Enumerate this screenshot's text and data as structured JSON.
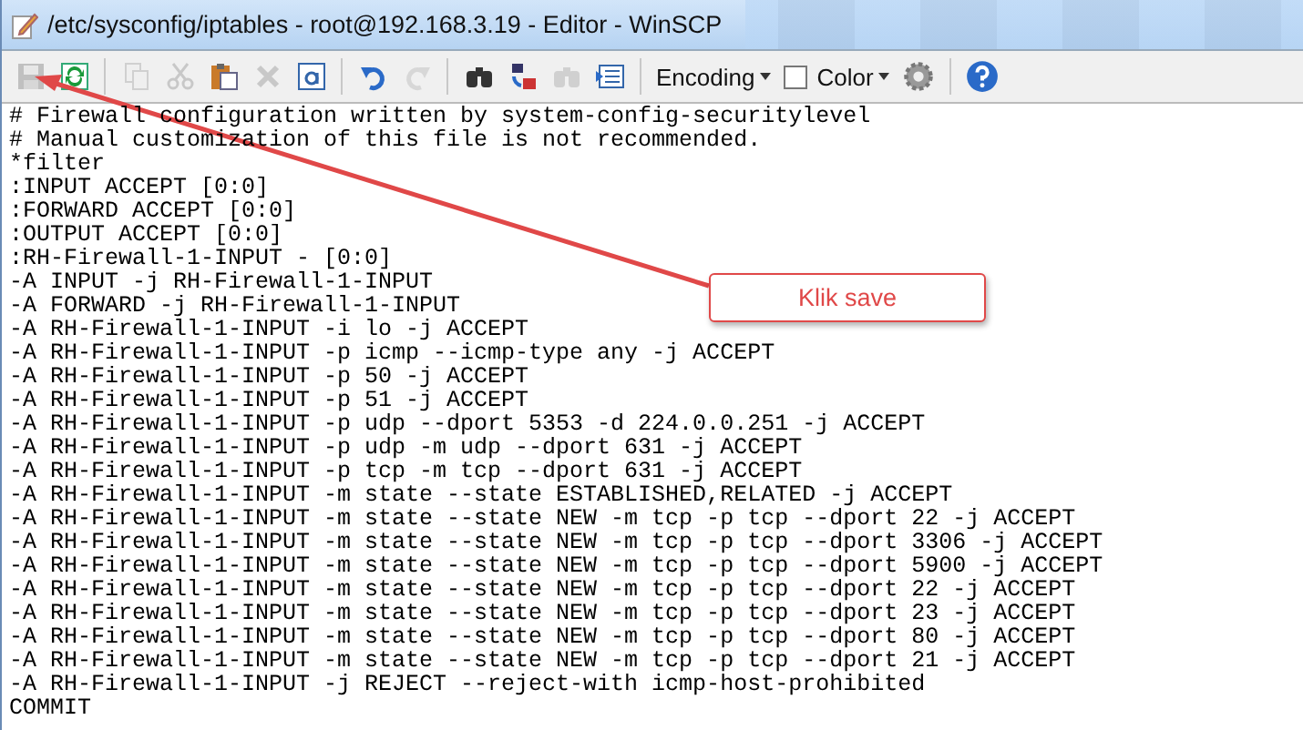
{
  "window": {
    "title": "/etc/sysconfig/iptables - root@192.168.3.19 - Editor - WinSCP"
  },
  "toolbar": {
    "groups": [
      [
        {
          "kind": "save",
          "disabled": true
        },
        {
          "kind": "reload",
          "disabled": false
        }
      ],
      [
        {
          "kind": "copy",
          "disabled": true
        },
        {
          "kind": "cut",
          "disabled": true
        },
        {
          "kind": "paste",
          "disabled": false
        },
        {
          "kind": "delete",
          "disabled": true
        },
        {
          "kind": "select-all",
          "disabled": false
        }
      ],
      [
        {
          "kind": "undo",
          "disabled": false
        },
        {
          "kind": "redo",
          "disabled": true
        }
      ],
      [
        {
          "kind": "find",
          "disabled": false
        },
        {
          "kind": "replace",
          "disabled": false
        },
        {
          "kind": "find-next",
          "disabled": true
        },
        {
          "kind": "goto",
          "disabled": false
        }
      ]
    ],
    "encoding": "Encoding",
    "color": {
      "label": "Color",
      "checked": false
    }
  },
  "editor": {
    "lines": [
      "# Firewall configuration written by system-config-securitylevel",
      "# Manual customization of this file is not recommended.",
      "*filter",
      ":INPUT ACCEPT [0:0]",
      ":FORWARD ACCEPT [0:0]",
      ":OUTPUT ACCEPT [0:0]",
      ":RH-Firewall-1-INPUT - [0:0]",
      "-A INPUT -j RH-Firewall-1-INPUT",
      "-A FORWARD -j RH-Firewall-1-INPUT",
      "-A RH-Firewall-1-INPUT -i lo -j ACCEPT",
      "-A RH-Firewall-1-INPUT -p icmp --icmp-type any -j ACCEPT",
      "-A RH-Firewall-1-INPUT -p 50 -j ACCEPT",
      "-A RH-Firewall-1-INPUT -p 51 -j ACCEPT",
      "-A RH-Firewall-1-INPUT -p udp --dport 5353 -d 224.0.0.251 -j ACCEPT",
      "-A RH-Firewall-1-INPUT -p udp -m udp --dport 631 -j ACCEPT",
      "-A RH-Firewall-1-INPUT -p tcp -m tcp --dport 631 -j ACCEPT",
      "-A RH-Firewall-1-INPUT -m state --state ESTABLISHED,RELATED -j ACCEPT",
      "-A RH-Firewall-1-INPUT -m state --state NEW -m tcp -p tcp --dport 22 -j ACCEPT",
      "-A RH-Firewall-1-INPUT -m state --state NEW -m tcp -p tcp --dport 3306 -j ACCEPT",
      "-A RH-Firewall-1-INPUT -m state --state NEW -m tcp -p tcp --dport 5900 -j ACCEPT",
      "-A RH-Firewall-1-INPUT -m state --state NEW -m tcp -p tcp --dport 22 -j ACCEPT",
      "-A RH-Firewall-1-INPUT -m state --state NEW -m tcp -p tcp --dport 23 -j ACCEPT",
      "-A RH-Firewall-1-INPUT -m state --state NEW -m tcp -p tcp --dport 80 -j ACCEPT",
      "-A RH-Firewall-1-INPUT -m state --state NEW -m tcp -p tcp --dport 21 -j ACCEPT",
      "-A RH-Firewall-1-INPUT -j REJECT --reject-with icmp-host-prohibited",
      "COMMIT"
    ]
  },
  "callout": {
    "text": "Klik save"
  }
}
